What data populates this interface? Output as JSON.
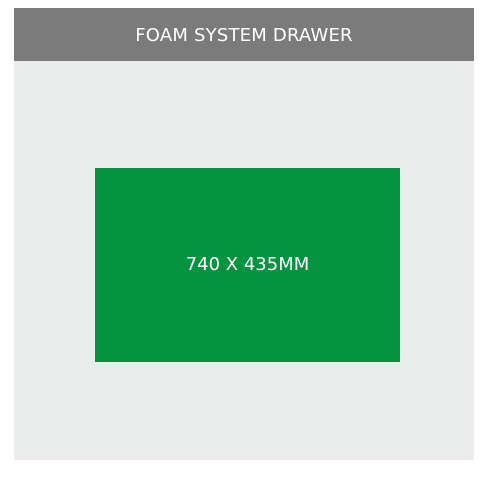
{
  "header": {
    "title": "FOAM SYSTEM DRAWER"
  },
  "drawer": {
    "dimensions_label": "740 X 435MM"
  },
  "colors": {
    "header_background": "#7b7b7b",
    "panel_background": "#ebedec",
    "drawer_fill": "#04933f",
    "text": "#ffffff"
  }
}
